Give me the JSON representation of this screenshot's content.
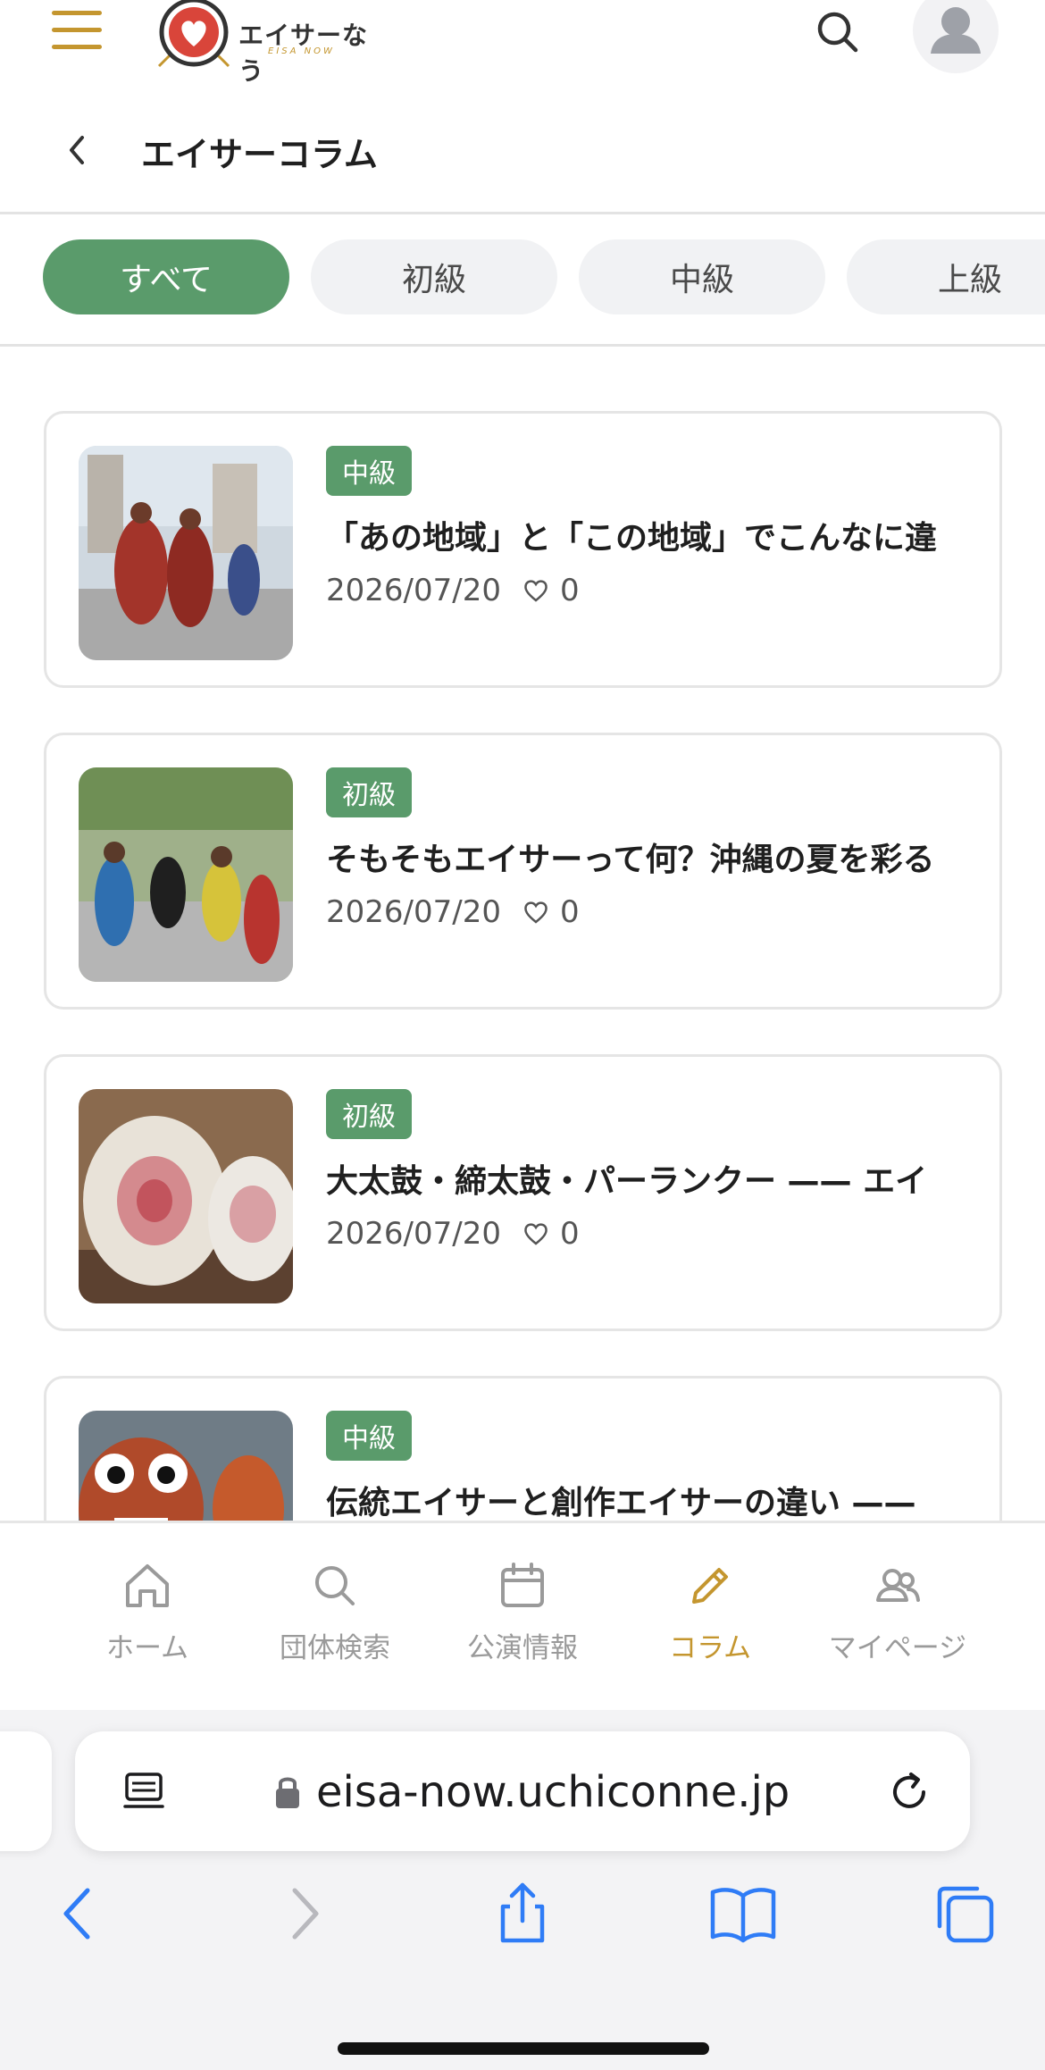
{
  "header": {
    "logo_text": "エイサーなう",
    "logo_sub": "EISA NOW",
    "page_title": "エイサーコラム"
  },
  "filters": [
    {
      "label": "すべて",
      "active": true
    },
    {
      "label": "初級",
      "active": false
    },
    {
      "label": "中級",
      "active": false
    },
    {
      "label": "上級",
      "active": false
    }
  ],
  "articles": [
    {
      "level": "中級",
      "title": "「あの地域」と「この地域」でこんなに違",
      "date": "2026/07/20",
      "likes": "0"
    },
    {
      "level": "初級",
      "title": "そもそもエイサーって何？沖縄の夏を彩る",
      "date": "2026/07/20",
      "likes": "0"
    },
    {
      "level": "初級",
      "title": "大太鼓・締太鼓・パーランクー —— エイ",
      "date": "2026/07/20",
      "likes": "0"
    },
    {
      "level": "中級",
      "title": "伝統エイサーと創作エイサーの違い ——",
      "date": "",
      "likes": ""
    }
  ],
  "bottom_nav": [
    {
      "label": "ホーム",
      "icon": "home-icon",
      "active": false
    },
    {
      "label": "団体検索",
      "icon": "search-icon",
      "active": false
    },
    {
      "label": "公演情報",
      "icon": "calendar-icon",
      "active": false
    },
    {
      "label": "コラム",
      "icon": "pencil-icon",
      "active": true
    },
    {
      "label": "マイページ",
      "icon": "users-icon",
      "active": false
    }
  ],
  "browser": {
    "url": "eisa-now.uchiconne.jp"
  },
  "colors": {
    "accent_green": "#5a9b6b",
    "accent_gold": "#c4962f",
    "logo_red": "#d9453a"
  }
}
